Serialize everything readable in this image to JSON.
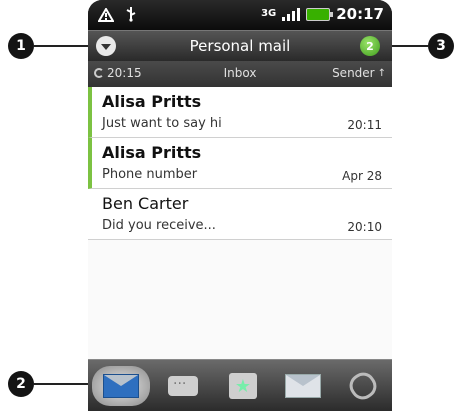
{
  "status_bar": {
    "network": "3G",
    "time": "20:17",
    "icons": [
      "alert-icon",
      "usb-icon",
      "signal-icon",
      "battery-icon"
    ]
  },
  "header": {
    "title": "Personal mail",
    "unread_count": "2"
  },
  "subheader": {
    "last_sync": "20:15",
    "folder": "Inbox",
    "sort": "Sender"
  },
  "messages": [
    {
      "sender": "Alisa Pritts",
      "subject": "Just want to say hi",
      "date": "20:11",
      "unread": true
    },
    {
      "sender": "Alisa Pritts",
      "subject": "Phone number",
      "date": "Apr 28",
      "unread": true
    },
    {
      "sender": "Ben Carter",
      "subject": "Did you receive...",
      "date": "20:10",
      "unread": false
    }
  ],
  "tabs": [
    "tab-all-mail",
    "tab-conversations",
    "tab-favorites",
    "tab-unread",
    "tab-attachments"
  ],
  "callouts": [
    "1",
    "2",
    "3"
  ],
  "colors": {
    "unread_accent": "#7cc242",
    "header_bg": "#2a2a2a",
    "badge": "#3f9d1c"
  }
}
